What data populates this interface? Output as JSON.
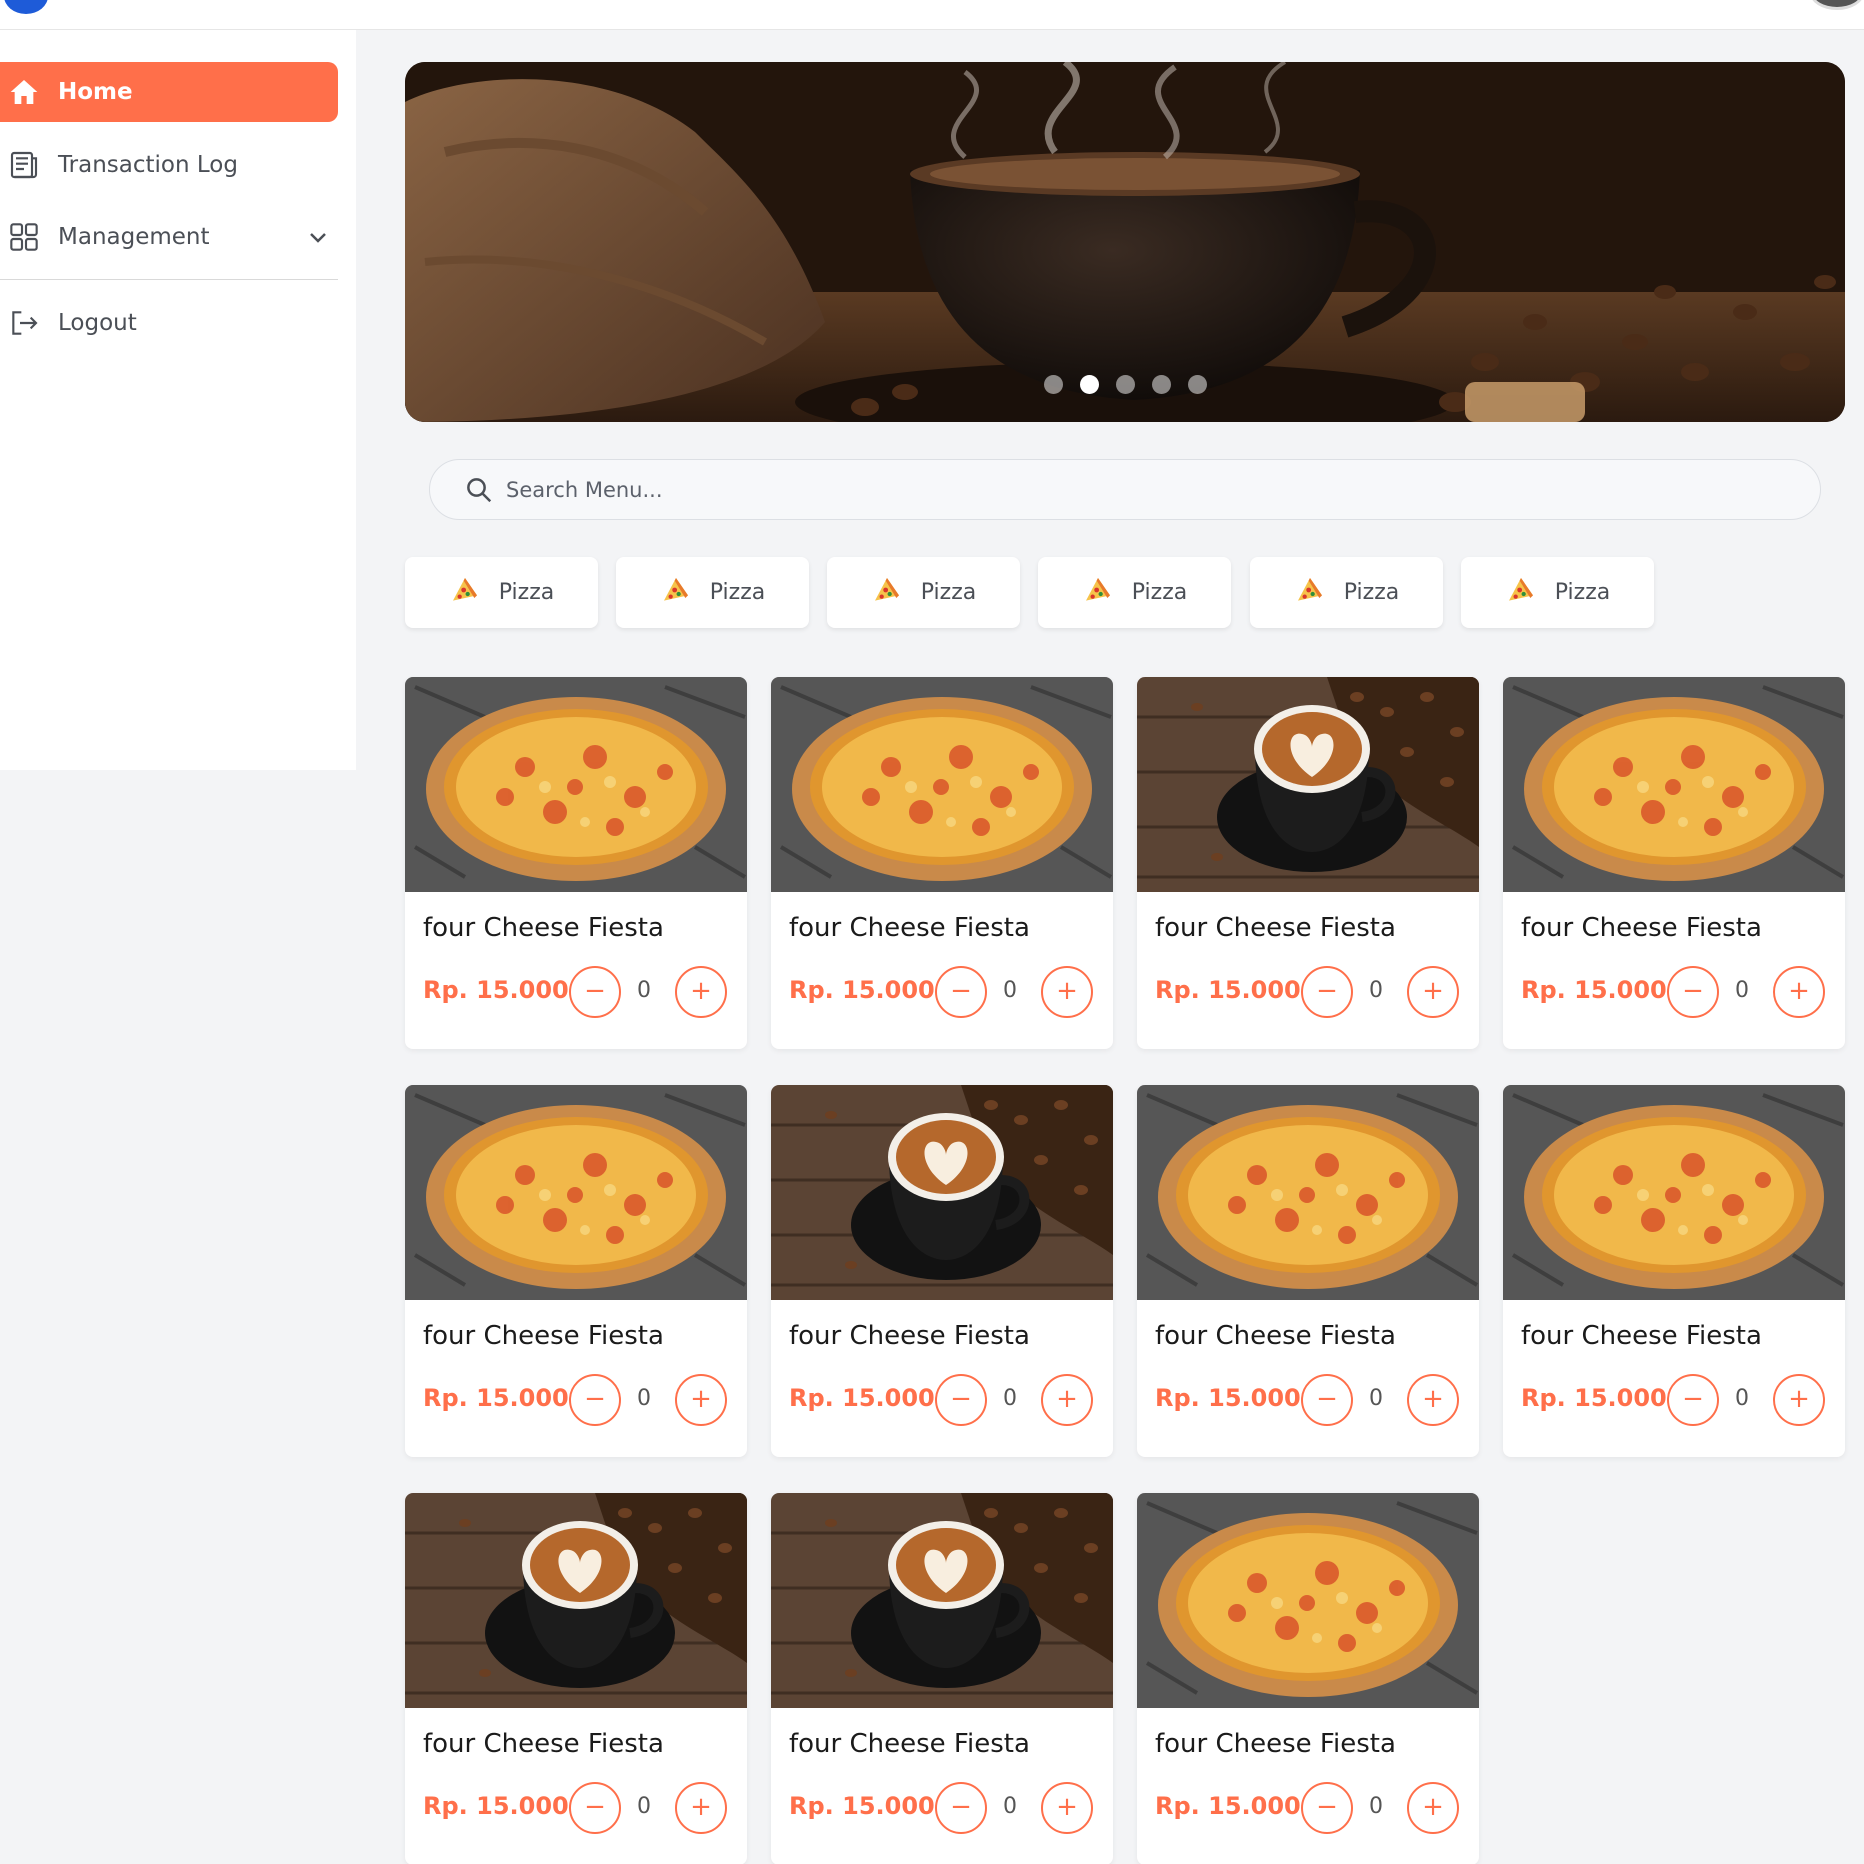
{
  "colors": {
    "accent": "#ff6f4a",
    "sidebar_bg": "#ffffff",
    "page_bg": "#f3f4f6"
  },
  "sidebar": {
    "items": [
      {
        "label": "Home",
        "icon": "home-icon",
        "active": true
      },
      {
        "label": "Transaction Log",
        "icon": "receipt-icon"
      },
      {
        "label": "Management",
        "icon": "grid-icon",
        "has_dropdown": true
      },
      {
        "label": "Logout",
        "icon": "logout-icon"
      }
    ]
  },
  "hero": {
    "slide_count": 5,
    "active_slide": 2
  },
  "search": {
    "placeholder": "Search Menu..."
  },
  "categories": [
    {
      "label": "Pizza",
      "icon": "pizza-icon"
    },
    {
      "label": "Pizza",
      "icon": "pizza-icon"
    },
    {
      "label": "Pizza",
      "icon": "pizza-icon"
    },
    {
      "label": "Pizza",
      "icon": "pizza-icon"
    },
    {
      "label": "Pizza",
      "icon": "pizza-icon"
    },
    {
      "label": "Pizza",
      "icon": "pizza-icon"
    }
  ],
  "products": [
    {
      "name": "four Cheese Fiesta",
      "price": "Rp. 15.000",
      "qty": "0",
      "image": "pizza"
    },
    {
      "name": "four Cheese Fiesta",
      "price": "Rp. 15.000",
      "qty": "0",
      "image": "pizza"
    },
    {
      "name": "four Cheese Fiesta",
      "price": "Rp. 15.000",
      "qty": "0",
      "image": "coffee"
    },
    {
      "name": "four Cheese Fiesta",
      "price": "Rp. 15.000",
      "qty": "0",
      "image": "pizza"
    },
    {
      "name": "four Cheese Fiesta",
      "price": "Rp. 15.000",
      "qty": "0",
      "image": "pizza"
    },
    {
      "name": "four Cheese Fiesta",
      "price": "Rp. 15.000",
      "qty": "0",
      "image": "coffee"
    },
    {
      "name": "four Cheese Fiesta",
      "price": "Rp. 15.000",
      "qty": "0",
      "image": "pizza"
    },
    {
      "name": "four Cheese Fiesta",
      "price": "Rp. 15.000",
      "qty": "0",
      "image": "pizza"
    },
    {
      "name": "four Cheese Fiesta",
      "price": "Rp. 15.000",
      "qty": "0",
      "image": "coffee"
    },
    {
      "name": "four Cheese Fiesta",
      "price": "Rp. 15.000",
      "qty": "0",
      "image": "coffee"
    },
    {
      "name": "four Cheese Fiesta",
      "price": "Rp. 15.000",
      "qty": "0",
      "image": "pizza"
    }
  ],
  "controls": {
    "minus_symbol": "−",
    "plus_symbol": "+"
  }
}
